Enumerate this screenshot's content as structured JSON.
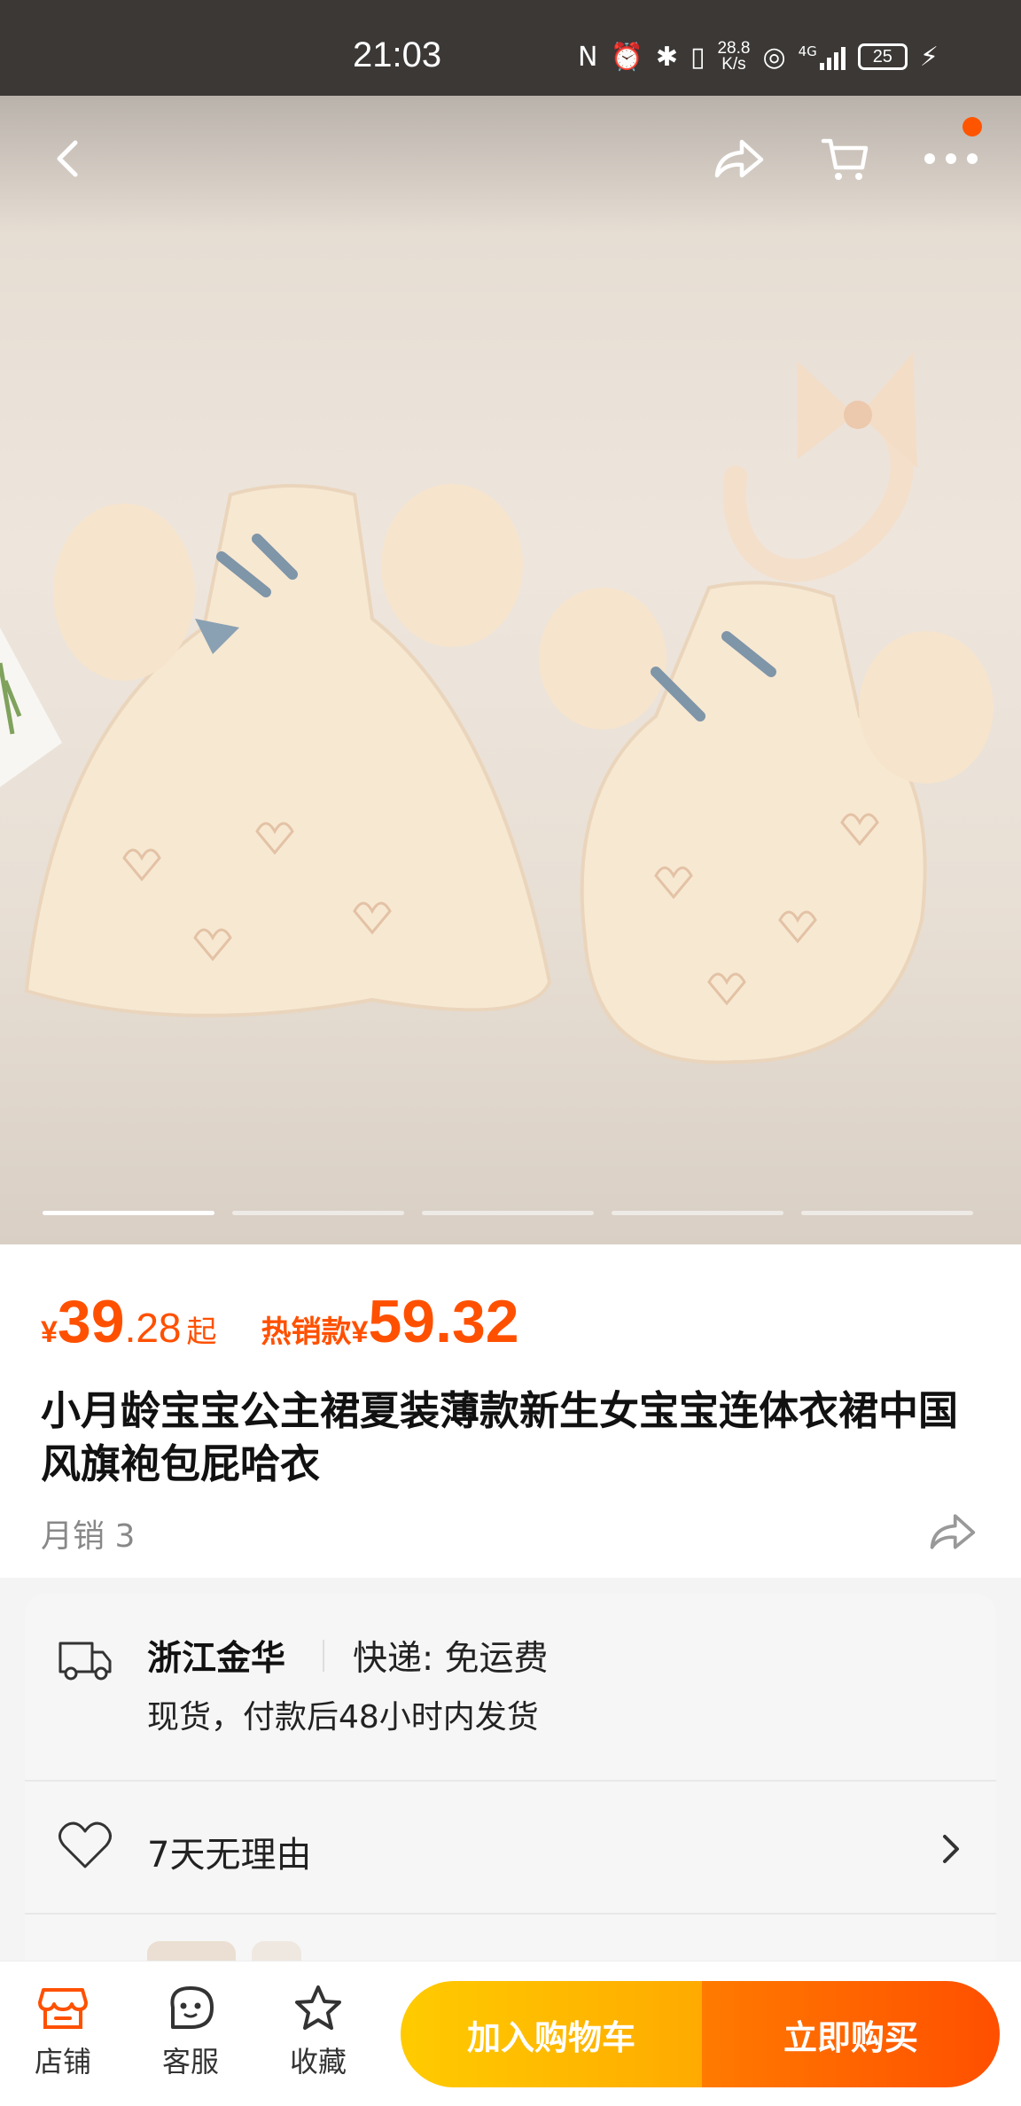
{
  "status_bar": {
    "time": "21:03",
    "net_speed_value": "28.8",
    "net_speed_unit": "K/s",
    "network_type": "4G",
    "battery": "25"
  },
  "nav": {
    "back_icon": "chevron-left-icon",
    "share_icon": "share-icon",
    "cart_icon": "cart-icon",
    "more_icon": "more-icon"
  },
  "gallery": {
    "current_index": 1,
    "total": 5
  },
  "price": {
    "currency": "¥",
    "integer": "39",
    "decimal": ".28",
    "suffix": "起",
    "hot_label": "热销款",
    "hot_currency": "¥",
    "hot_price": "59.32"
  },
  "product": {
    "title": "小月龄宝宝公主裙夏装薄款新生女宝宝连体衣裙中国风旗袍包屁哈衣",
    "monthly_sales": "月销 3"
  },
  "delivery": {
    "origin": "浙江金华",
    "shipping": "快递: 免运费",
    "stock": "现货，付款后48小时内发货"
  },
  "service": {
    "returns": "7天无理由"
  },
  "bottom_bar": {
    "store_label": "店铺",
    "service_label": "客服",
    "favorite_label": "收藏",
    "add_to_cart_label": "加入购物车",
    "buy_now_label": "立即购买"
  },
  "colors": {
    "accent": "#ff5000",
    "cart_button": "#ffb800",
    "buy_button": "#ff5a00"
  }
}
